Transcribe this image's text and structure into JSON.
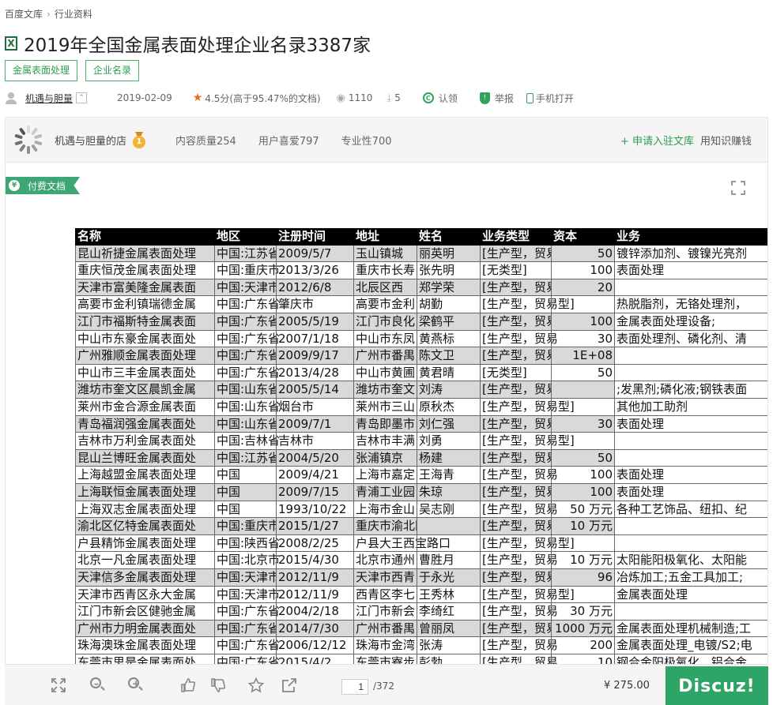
{
  "breadcrumb": [
    "百度文库",
    "行业资料"
  ],
  "title": "2019年全国金属表面处理企业名录3387家",
  "file_icon_glyph": "X",
  "tags": [
    "金属表面处理",
    "企业名录"
  ],
  "meta": {
    "uploader": "机遇与胆量",
    "date": "2019-02-09",
    "rating": "4.5分",
    "rating_note": "(高于95.47%的文档)",
    "views": "1110",
    "downloads": "5",
    "claim": "认领",
    "report": "举报",
    "mobile": "手机打开"
  },
  "store": {
    "name": "机遇与胆量的店",
    "content_quality": "内容质量254",
    "user_likes": "用户喜爱797",
    "professionalism": "专业性700",
    "apply": "+ 申请入驻文库",
    "earn": "用知识赚钱"
  },
  "paid_label": "付费文档",
  "sheet": {
    "headers": [
      "名称",
      "地区",
      "注册时间",
      "地址",
      "姓名",
      "业务类型",
      "资本",
      "业务"
    ],
    "rows": [
      [
        "昆山祈捷金属表面处理",
        "中国:江苏省",
        "2009/5/7",
        "玉山镇城",
        "丽英明",
        "[生产型，贸易",
        "50",
        "镀锌添加剂、镀镍光亮剂"
      ],
      [
        "重庆恒茂金属表面处理",
        "中国:重庆市",
        "2013/3/26",
        "重庆市长寿",
        "张先明",
        "[无类型]",
        "100",
        "表面处理"
      ],
      [
        "天津市富美隆金属表面",
        "中国:天津市",
        "2012/6/8",
        "北辰区西",
        "郑学荣",
        "[生产型，贸易",
        "20",
        ""
      ],
      [
        "高要市金利镇瑞德金属",
        "中国:广东省",
        "肇庆市",
        "高要市金利",
        "胡勤",
        "[生产型，贸易型]",
        "",
        "热脱脂剂，无铬处理剂，"
      ],
      [
        "江门市福斯特金属表面",
        "中国:广东省",
        "2005/5/19",
        "江门市良化",
        "梁鹤平",
        "[生产型，贸易",
        "100",
        "金属表面处理设备;"
      ],
      [
        "中山市东豪金属表面处",
        "中国:广东省",
        "2007/1/18",
        "中山市东凤",
        "黄燕标",
        "[生产型，贸易",
        "30",
        "表面处理剂、磷化剂、清"
      ],
      [
        "广州雅顺金属表面处理",
        "中国:广东省",
        "2009/9/17",
        "广州市番禺",
        "陈文卫",
        "[生产型，贸易",
        "1E+08",
        ""
      ],
      [
        "中山市三丰金属表面处",
        "中国:广东省",
        "2013/4/28",
        "中山市黄圃",
        "黄君晴",
        "[无类型]",
        "50",
        ""
      ],
      [
        "潍坊市奎文区晨凯金属",
        "中国:山东省",
        "2005/5/14",
        "潍坊市奎文",
        "刘涛",
        "[生产型，贸易型]",
        "",
        ";发黑剂;磷化液;钢铁表面"
      ],
      [
        "莱州市金合源金属表面",
        "中国:山东省",
        "烟台市",
        "莱州市三山",
        "原秋杰",
        "[生产型，贸易型]",
        "",
        "其他加工助剂"
      ],
      [
        "青岛福润强金属表面处",
        "中国:山东省",
        "2009/7/1",
        "青岛即墨市",
        "刘仁强",
        "[生产型，贸易",
        "30",
        "表面处理"
      ],
      [
        "吉林市万利金属表面处",
        "中国:吉林省",
        "吉林市",
        "吉林市丰满",
        "刘勇",
        "[生产型，贸易型]",
        "",
        ""
      ],
      [
        "昆山兰博旺金属表面处",
        "中国:江苏省",
        "2004/5/20",
        "张浦镇京",
        "杨建",
        "[生产型，贸易",
        "50",
        ""
      ],
      [
        "上海越盟金属表面处理",
        "中国",
        "2009/4/21",
        "上海市嘉定",
        "王海青",
        "[生产型，贸易",
        "100",
        "表面处理"
      ],
      [
        "上海联恒金属表面处理",
        "中国",
        "2009/7/15",
        "青浦工业园",
        "朱琼",
        "[生产型，贸易",
        "100",
        "表面处理"
      ],
      [
        "上海双志金属表面处理",
        "中国",
        "1993/10/22",
        "上海市金山",
        "吴志刚",
        "[生产型，贸易",
        "50 万元",
        "各种工艺饰品、纽扣、纪"
      ],
      [
        "渝北区亿特金属表面处",
        "中国:重庆市",
        "2015/1/27",
        "重庆市渝北区回兴街道",
        "",
        "[生产型，贸易",
        "10 万元",
        ""
      ],
      [
        "户县精饰金属表面处理",
        "中国:陕西省",
        "2008/2/25",
        "户县大王西宝路口",
        "",
        "[生产型，贸易型]",
        "",
        ""
      ],
      [
        "北京一凡金属表面处理",
        "中国:北京市",
        "2015/4/30",
        "北京市通州",
        "曹胜月",
        "[生产型，贸易",
        "10 万元",
        "太阳能阳极氧化、太阳能"
      ],
      [
        "天津信多金属表面处理",
        "中国:天津市",
        "2012/11/9",
        "天津市西青",
        "于永光",
        "[生产型，贸易",
        "96",
        "冶炼加工;五金工具加工;"
      ],
      [
        "天津市西青区永大金属",
        "中国:天津市",
        "2012/11/9",
        "西青区李七",
        "王秀林",
        "[生产型，贸易型]",
        "",
        "金属表面处理"
      ],
      [
        "江门市新会区健驰金属",
        "中国:广东省",
        "2004/2/18",
        "江门市新会",
        "李绮红",
        "[生产型，贸易",
        "30 万元",
        ""
      ],
      [
        "广州市力明金属表面处",
        "中国:广东省",
        "2014/7/30",
        "广州市番禺",
        "曾丽凤",
        "[生产型，贸易",
        "1000 万元",
        "金属表面处理机械制造;工"
      ],
      [
        "珠海澳珠金属表面处理",
        "中国:广东省",
        "2006/12/12",
        "珠海市金湾",
        "张涛",
        "[生产型，贸易",
        "200",
        "金属表面处理_电镀/S2;电"
      ],
      [
        "东莞市思是金属表面处",
        "中国:广东省",
        "2015/4/2",
        "东莞市寮步",
        "彭勃",
        "[生产型，贸易",
        "10",
        "钢合金阳极氧化，铝合金"
      ]
    ]
  },
  "toolbar": {
    "page_current": "1",
    "page_total": "/372",
    "price": "¥ 275.00",
    "buy_label": "Discuz!"
  }
}
